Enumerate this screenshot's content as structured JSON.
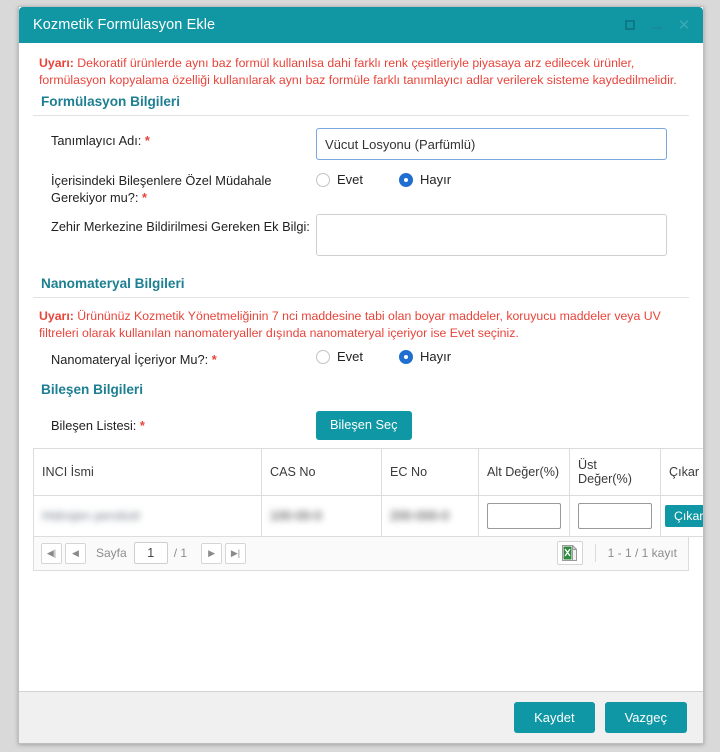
{
  "window": {
    "title": "Kozmetik Formülasyon Ekle",
    "controls": {
      "maximize": "maximize",
      "minimize": "minimize",
      "close": "close"
    },
    "accent_color": "#1196a4",
    "warning_color": "#e8443a",
    "section_heading_color": "#1d7f92",
    "radio_selected_color": "#1f6fd0"
  },
  "top_warning": {
    "prefix": "Uyarı:",
    "text": " Dekoratif ürünlerde aynı baz formül kullanılsa dahi farklı renk çeşitleriyle piyasaya arz edilecek ürünler, formülasyon kopyalama özelliği kullanılarak aynı baz formüle farklı tanımlayıcı adlar verilerek sisteme kaydedilmelidir."
  },
  "formulation_section": {
    "heading": "Formülasyon Bilgileri",
    "identifier": {
      "label": "Tanımlayıcı Adı:",
      "required": "*",
      "value": "Vücut Losyonu (Parfümlü)",
      "placeholder": ""
    },
    "special_intervention": {
      "label": "İçerisindeki Bileşenlere Özel Müdahale Gerekiyor mu?:",
      "required": "*",
      "options": [
        "Evet",
        "Hayır"
      ],
      "selected": "Hayır"
    },
    "poison_center": {
      "label": "Zehir Merkezine Bildirilmesi Gereken Ek Bilgi:",
      "value": "",
      "placeholder": ""
    }
  },
  "nanomaterial_section": {
    "heading": "Nanomateryal Bilgileri",
    "warning": {
      "prefix": "Uyarı:",
      "text": " Ürününüz Kozmetik Yönetmeliğinin 7 nci maddesine tabi olan boyar maddeler, koruyucu maddeler veya UV filtreleri olarak kullanılan nanomateryaller dışında nanomateryal içeriyor ise Evet seçiniz."
    },
    "contains": {
      "label": "Nanomateryal İçeriyor Mu?:",
      "required": "*",
      "options": [
        "Evet",
        "Hayır"
      ],
      "selected": "Hayır"
    }
  },
  "component_section": {
    "heading": "Bileşen Bilgileri",
    "list_label": "Bileşen Listesi:",
    "required": "*",
    "select_button": "Bileşen Seç",
    "table": {
      "columns": [
        "INCI İsmi",
        "CAS No",
        "EC No",
        "Alt Değer(%)",
        "Üst Değer(%)",
        "Çıkar"
      ],
      "rows": [
        {
          "inci_name": "Hidrojen peroksit",
          "cas_no": "100-00-0",
          "ec_no": "200-000-0",
          "redacted": true,
          "lower_value": "",
          "upper_value": "",
          "remove_button": "Çıkar"
        }
      ]
    },
    "pager": {
      "first_icon": "first-page-icon",
      "prev_icon": "previous-page-icon",
      "page_label": "Sayfa",
      "page_value": "1",
      "total_pages": "/ 1",
      "next_icon": "next-page-icon",
      "last_icon": "last-page-icon",
      "excel_icon": "excel-export-icon",
      "record_count": "1 - 1 / 1 kayıt"
    }
  },
  "footer": {
    "save_label": "Kaydet",
    "cancel_label": "Vazgeç"
  }
}
